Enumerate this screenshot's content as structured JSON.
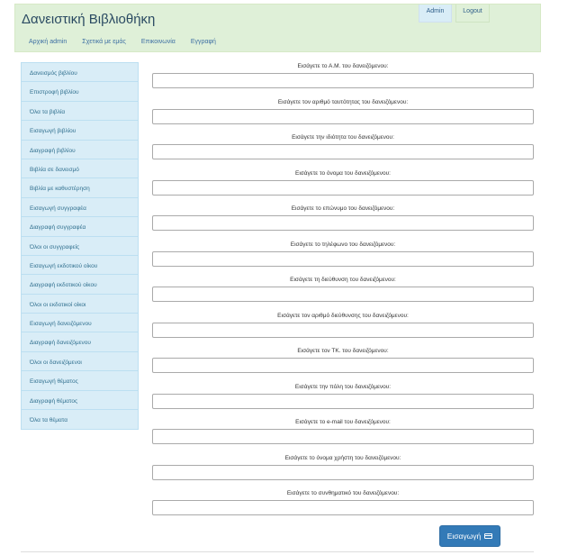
{
  "app": {
    "title": "Δανειστική Βιβλιοθήκη",
    "admin_label": "Admin",
    "logout_label": "Logout"
  },
  "nav": [
    {
      "label": "Αρχική admin"
    },
    {
      "label": "Σχετικά με εμάς"
    },
    {
      "label": "Επικοινωνία"
    },
    {
      "label": "Εγγραφή"
    }
  ],
  "sidebar": {
    "items": [
      {
        "label": "Δανεισμός βιβλίου"
      },
      {
        "label": "Επιστροφή βιβλίου"
      },
      {
        "label": "Όλα τα βιβλία"
      },
      {
        "label": "Εισαγωγή βιβλίου"
      },
      {
        "label": "Διαγραφή βιβλίου"
      },
      {
        "label": "Βιβλία σε δανεισμό"
      },
      {
        "label": "Βιβλία με καθυστέρηση"
      },
      {
        "label": "Εισαγωγή συγγραφέα"
      },
      {
        "label": "Διαγραφή συγγραφέα"
      },
      {
        "label": "Όλοι οι συγγραφείς"
      },
      {
        "label": "Εισαγωγή εκδοτικού οίκου"
      },
      {
        "label": "Διαγραφή εκδοτικού οίκου"
      },
      {
        "label": "Όλοι οι εκδοτικοί οίκοι"
      },
      {
        "label": "Εισαγωγή δανειζόμενου"
      },
      {
        "label": "Διαγραφή δανειζόμενου"
      },
      {
        "label": "Όλοι οι δανειζόμενοι"
      },
      {
        "label": "Εισαγωγή θέματος"
      },
      {
        "label": "Διαγραφή θέματος"
      },
      {
        "label": "Όλα τα θέματα"
      }
    ]
  },
  "form": {
    "fields": [
      {
        "label": "Εισάγετε το Α.Μ. του δανειζόμενου:",
        "value": ""
      },
      {
        "label": "Εισάγετε τον αριθμό ταυτότητας του δανειζόμενου:",
        "value": ""
      },
      {
        "label": "Εισάγετε την ιδιότητα του δανειζόμενου:",
        "value": ""
      },
      {
        "label": "Εισάγετε το όνομα του δανειζόμενου:",
        "value": ""
      },
      {
        "label": "Εισάγετε το επώνυμο του δανειζόμενου:",
        "value": ""
      },
      {
        "label": "Εισάγετε το τηλέφωνο του δανειζόμενου:",
        "value": ""
      },
      {
        "label": "Εισάγετε τη διεύθυνση του δανειζόμενου:",
        "value": ""
      },
      {
        "label": "Εισάγετε τον αριθμό διεύθυνσης του δανειζόμενου:",
        "value": ""
      },
      {
        "label": "Εισάγετε τον ΤΚ. του δανειζόμενου:",
        "value": ""
      },
      {
        "label": "Εισάγετε την πόλη του δανειζόμενου:",
        "value": ""
      },
      {
        "label": "Εισάγετε το e-mail του δανειζόμενου:",
        "value": ""
      },
      {
        "label": "Εισάγετε το όνομα χρήστη του δανειζόμενου:",
        "value": ""
      },
      {
        "label": "Εισάγετε το συνθηματικό του δανειζόμενου:",
        "value": ""
      }
    ],
    "submit_label": "Εισαγωγή",
    "submit_icon": "credit-card-icon"
  }
}
